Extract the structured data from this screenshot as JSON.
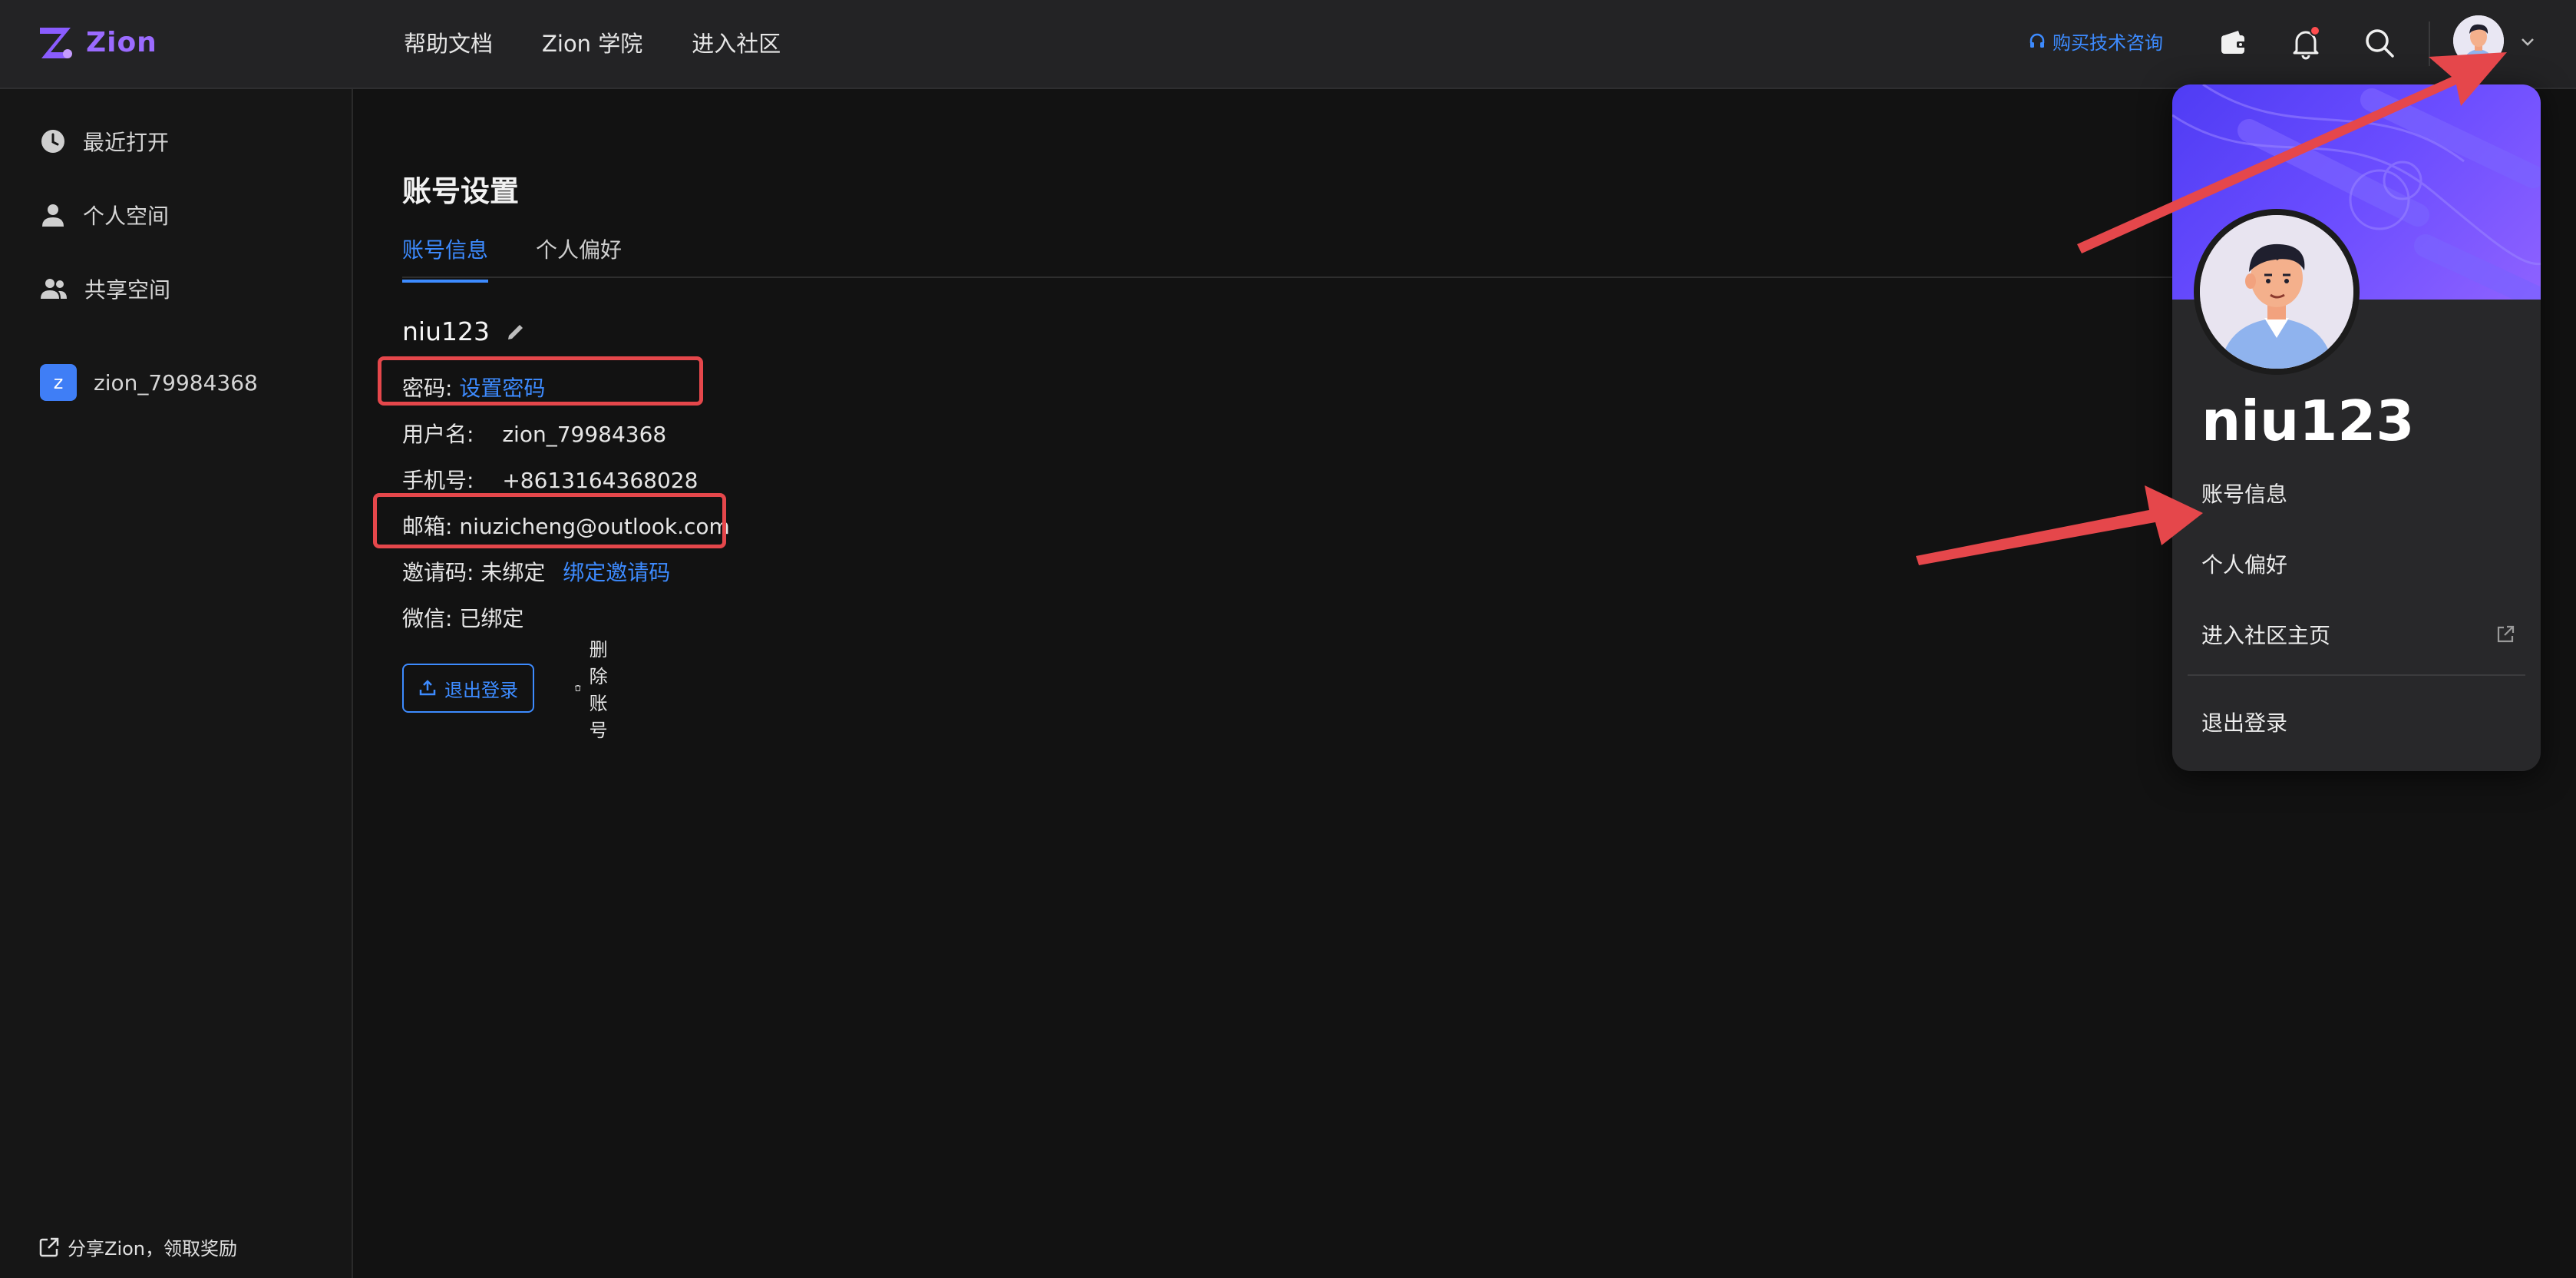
{
  "app": {
    "brand": "Zion"
  },
  "nav": {
    "items": [
      "帮助文档",
      "Zion 学院",
      "进入社区"
    ]
  },
  "toolbar": {
    "consult_label": "购买技术咨询",
    "icons": [
      "wallet-icon",
      "bell-icon",
      "search-icon",
      "chevron-down-icon"
    ],
    "notification_dot_color": "#ff4d4f"
  },
  "sidebar": {
    "items": [
      {
        "label": "最近打开",
        "icon": "clock-icon"
      },
      {
        "label": "个人空间",
        "icon": "person-icon"
      },
      {
        "label": "共享空间",
        "icon": "people-icon"
      }
    ],
    "workspace": {
      "badge": "z",
      "label": "zion_79984368"
    },
    "share_label": "分享Zion，领取奖励"
  },
  "account": {
    "title": "账号设置",
    "tabs": [
      {
        "label": "账号信息",
        "active": true
      },
      {
        "label": "个人偏好",
        "active": false
      }
    ],
    "display_name": "niu123",
    "password": {
      "label": "密码:",
      "action": "设置密码"
    },
    "username": {
      "label": "用户名:",
      "value": "zion_79984368"
    },
    "phone": {
      "label": "手机号:",
      "value": "+8613164368028"
    },
    "email": {
      "label": "邮箱:",
      "value": "niuzicheng@outlook.com"
    },
    "invite": {
      "label": "邀请码:",
      "value": "未绑定",
      "action": "绑定邀请码"
    },
    "wechat": {
      "label": "微信:",
      "value": "已绑定"
    },
    "logout_label": "退出登录",
    "delete_label": "删除账号"
  },
  "profile_card": {
    "name": "niu123",
    "items": [
      "账号信息",
      "个人偏好",
      "进入社区主页"
    ],
    "logout": "退出登录"
  },
  "colors": {
    "accent": "#3d8bff",
    "highlight": "#e5474b",
    "brand": "#9b6bff"
  }
}
